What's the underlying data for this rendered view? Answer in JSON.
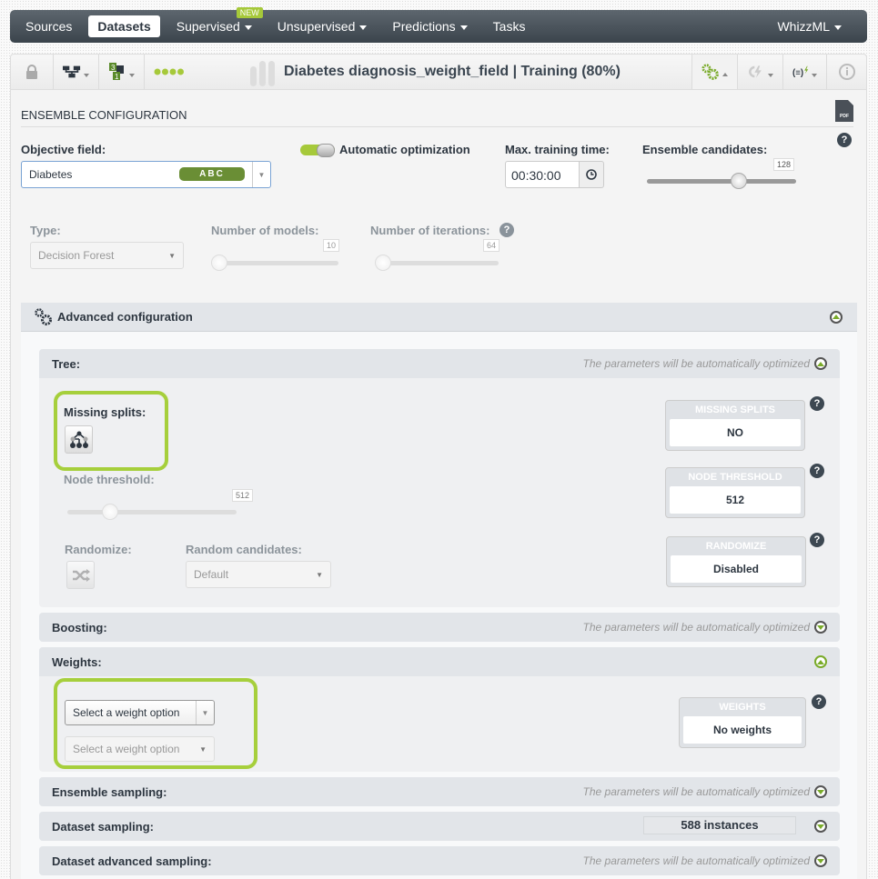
{
  "nav": {
    "items": [
      {
        "label": "Sources",
        "active": false,
        "dropdown": false
      },
      {
        "label": "Datasets",
        "active": true,
        "dropdown": false
      },
      {
        "label": "Supervised",
        "active": false,
        "dropdown": true,
        "badge": "NEW"
      },
      {
        "label": "Unsupervised",
        "active": false,
        "dropdown": true
      },
      {
        "label": "Predictions",
        "active": false,
        "dropdown": true
      },
      {
        "label": "Tasks",
        "active": false,
        "dropdown": false
      }
    ],
    "right_label": "WhizzML"
  },
  "toolbar": {
    "title": "Diabetes diagnosis_weight_field | Training (80%)",
    "icons": [
      "lock-icon",
      "tree-structure-icon",
      "field-counts-icon",
      "progress-dots-icon",
      "gears-icon",
      "lightning-reload-icon",
      "formula-lightning-icon",
      "info-icon"
    ]
  },
  "config": {
    "section_title": "ENSEMBLE CONFIGURATION",
    "pdf_label": "PDF",
    "objective_label": "Objective field:",
    "objective_value": "Diabetes",
    "objective_type": "ABC",
    "auto_opt_label": "Automatic optimization",
    "auto_opt_enabled": true,
    "max_time_label": "Max. training time:",
    "max_time_value": "00:30:00",
    "candidates_label": "Ensemble candidates:",
    "candidates_value": "128",
    "type_label": "Type:",
    "type_value": "Decision Forest",
    "models_label": "Number of models:",
    "models_value": "10",
    "iterations_label": "Number of iterations:",
    "iterations_value": "64"
  },
  "advanced": {
    "title": "Advanced configuration",
    "auto_text": "The parameters will be automatically optimized",
    "tree": {
      "title": "Tree:",
      "missing_splits_label": "Missing splits:",
      "node_threshold_label": "Node threshold:",
      "node_threshold_value": "512",
      "randomize_label": "Randomize:",
      "random_candidates_label": "Random candidates:",
      "random_candidates_value": "Default",
      "summary": [
        {
          "header": "MISSING SPLITS",
          "value": "NO"
        },
        {
          "header": "NODE THRESHOLD",
          "value": "512"
        },
        {
          "header": "RANDOMIZE",
          "value": "Disabled"
        }
      ]
    },
    "boosting": {
      "title": "Boosting:"
    },
    "weights": {
      "title": "Weights:",
      "select1": "Select a weight option",
      "select2": "Select a weight option",
      "summary_header": "WEIGHTS",
      "summary_value": "No weights"
    },
    "ensemble_sampling": {
      "title": "Ensemble sampling:"
    },
    "dataset_sampling": {
      "title": "Dataset sampling:",
      "value": "588 instances"
    },
    "dataset_advanced_sampling": {
      "title": "Dataset advanced sampling:"
    }
  }
}
